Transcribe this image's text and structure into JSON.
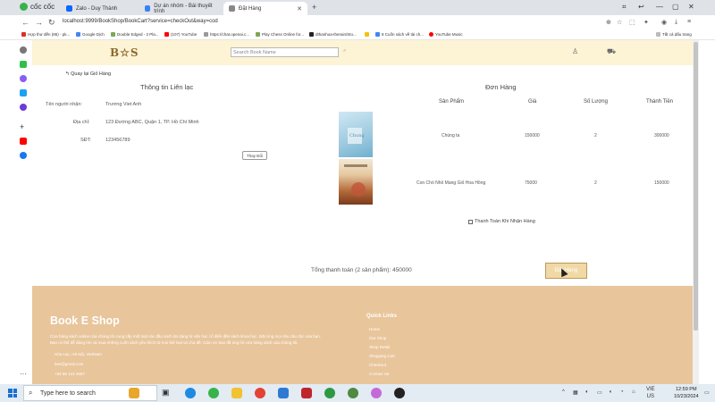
{
  "browser": {
    "brand": "cốc cốc",
    "tabs": [
      {
        "title": "Zalo - Duy Thành",
        "active": false
      },
      {
        "title": "Dự án nhóm - Bài thuyết trình",
        "active": false
      },
      {
        "title": "Đặt Hàng",
        "active": true
      }
    ],
    "url": "localhost:9999/BookShop/BookCart?service=checkOut&way=cod",
    "bookmarks": [
      "Hợp thư đến (86) - pk...",
      "Google Dịch",
      "Double Edged - 2 Pla...",
      "(107) YouTube",
      "https://chat.openai.c...",
      "Play Chess Online for...",
      "dthanhoa-therain/Sto...",
      "8 Cuốn sách về tài ch...",
      "YouTube Music",
      "Tất cả dấu trang"
    ]
  },
  "header": {
    "brand": "B☆S",
    "search_placeholder": "Search Book Name"
  },
  "back_link": "↰ Quay lại Giỏ Hàng",
  "contact": {
    "title": "Thông tin Liên lạc",
    "rows": [
      {
        "label": "Tên người nhận:",
        "value": "Trương Viet Anh"
      },
      {
        "label": "Địa chỉ:",
        "value": "123 Đường ABC, Quận 1, TP. Hồ Chí Minh"
      },
      {
        "label": "SĐT:",
        "value": "123456789"
      }
    ],
    "change_button": "Thay Đổi"
  },
  "order": {
    "title": "Đơn Hàng",
    "columns": [
      "Sản Phẩm",
      "Giá",
      "Số Lượng",
      "Thành Tiền"
    ],
    "items": [
      {
        "name": "Chúng ta",
        "price": "150000",
        "qty": "2",
        "subtotal": "300000"
      },
      {
        "name": "Con Chó Nhỏ Mang Giỏ Hoa Hồng",
        "price": "75000",
        "qty": "2",
        "subtotal": "150000"
      }
    ],
    "payment_option": "Thanh Toán Khi Nhận Hàng",
    "total_label": "Tổng thanh toán (2 sản phẩm):",
    "total_value": "450000",
    "order_button": "Đặt Hàng"
  },
  "footer": {
    "title": "Book E Shop",
    "description": "Cửa hàng sách online của chúng tôi cung cấp một loạt các đầu sách đa dạng từ văn học cổ điển đến sách khoa học. Đặt ứng mọi nhu cầu đọc của bạn. Bạn có thể dễ dàng tìm và mua những cuốn sách yêu thích từ mọi thể loại và chủ đề. Cảm ơn bạn đã ủng hộ cửa hàng sách của chúng tôi.",
    "address": "Hòa Lạc, Hà Nội, VietNam",
    "email": "bes@gmail.com",
    "phone": "+84 96 123 4567",
    "links_title": "Quick Links",
    "links": [
      "Home",
      "Our Shop",
      "Shop Detail",
      "Shopping Cart",
      "Checkout",
      "Contact Us"
    ]
  },
  "taskbar": {
    "search_placeholder": "Type here to search",
    "lang": "VIE",
    "region": "US",
    "time": "12:59 PM",
    "date": "10/23/2024"
  },
  "colors": {
    "header_bg": "#fdf3d5",
    "footer_bg": "#e8c59b",
    "order_button_bg": "#f1d9a6"
  }
}
